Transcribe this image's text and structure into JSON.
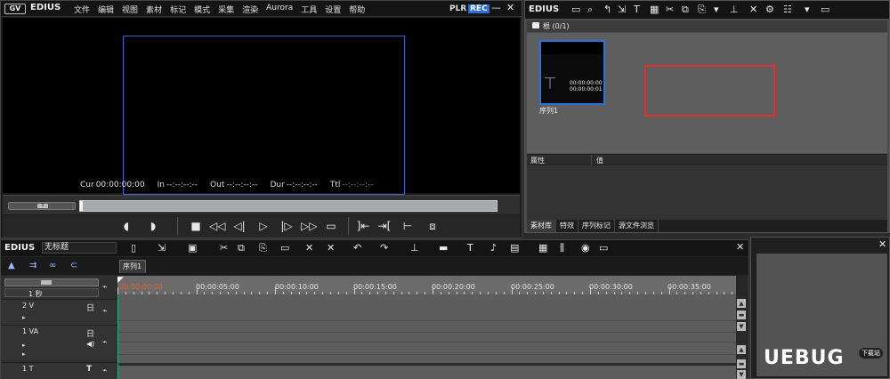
{
  "player": {
    "app_logo": "GV",
    "app_name": "EDIUS",
    "menu": [
      "文件",
      "编辑",
      "视图",
      "素材",
      "标记",
      "模式",
      "采集",
      "渲染",
      "Aurora",
      "工具",
      "设置",
      "帮助"
    ],
    "plr_label": "PLR",
    "rec_label": "REC",
    "timecodes": [
      {
        "label": "Cur",
        "value": "00:00:00:00",
        "dim": false
      },
      {
        "label": "In",
        "value": "--:--:--:--",
        "dim": false
      },
      {
        "label": "Out",
        "value": "--:--:--:--",
        "dim": false
      },
      {
        "label": "Dur",
        "value": "--:--:--:--",
        "dim": false
      },
      {
        "label": "Ttl",
        "value": "--:--:--:--",
        "dim": true
      }
    ],
    "shuttle_knob": "II"
  },
  "bin": {
    "name": "EDIUS",
    "folder_label": "根 (0/1)",
    "clip": {
      "name": "序列1",
      "tc1": "00:00:00:00",
      "tc2": "00:00:00:01"
    },
    "props_headers": [
      "属性",
      "值"
    ],
    "tabs": [
      "素材库",
      "特效",
      "序列标记",
      "源文件浏览"
    ]
  },
  "timeline": {
    "app_name": "EDIUS",
    "project_name": "无标题",
    "sequence_tab": "序列1",
    "scale_value": "1 秒",
    "ruler": [
      "00:00:00:00",
      "00:00:05:00",
      "00:00:10:00",
      "00:00:15:00",
      "00:00:20:00",
      "00:00:25:00",
      "00:00:30:00",
      "00:00:35:00"
    ],
    "tracks": [
      {
        "name": "2 V",
        "icon": "日"
      },
      {
        "name": "1 VA",
        "icon": "日",
        "icon2": "◀)"
      },
      {
        "name": "1 T",
        "icon": "T"
      }
    ]
  },
  "watermark": {
    "text": "UEBUG",
    "sub": "下载站"
  },
  "colors": {
    "rec": "#2b6fd8",
    "selection": "#2c72e0",
    "highlight": "#e03030",
    "timecode_start": "#e06030"
  }
}
